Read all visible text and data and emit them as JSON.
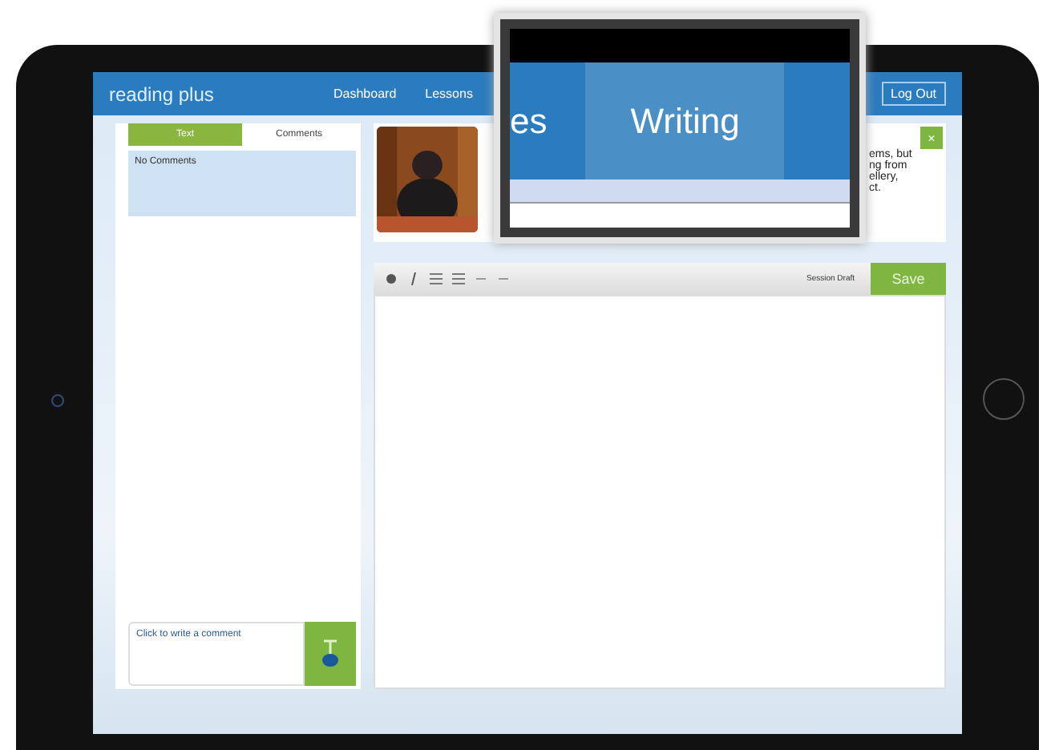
{
  "header": {
    "logo": "reading plus",
    "nav": [
      {
        "label": "Dashboard"
      },
      {
        "label": "Lessons"
      }
    ],
    "log_out": "Log Out"
  },
  "comments_panel": {
    "tabs": [
      {
        "label": "Text",
        "selected": true
      },
      {
        "label": "Comments",
        "selected": false
      }
    ],
    "comments": [
      "No Comments"
    ],
    "comment_input": {
      "placeholder": "Click to write a comment"
    }
  },
  "article": {
    "excerpt_lines": [
      "ems, but",
      "ng from",
      "ellery,",
      "ct."
    ],
    "close": "×"
  },
  "editor": {
    "status": "Session Draft",
    "save": "Save"
  },
  "zoom_callout": {
    "tabs": [
      {
        "label": "es",
        "selected": false
      },
      {
        "label": "Writing",
        "selected": true
      }
    ]
  }
}
